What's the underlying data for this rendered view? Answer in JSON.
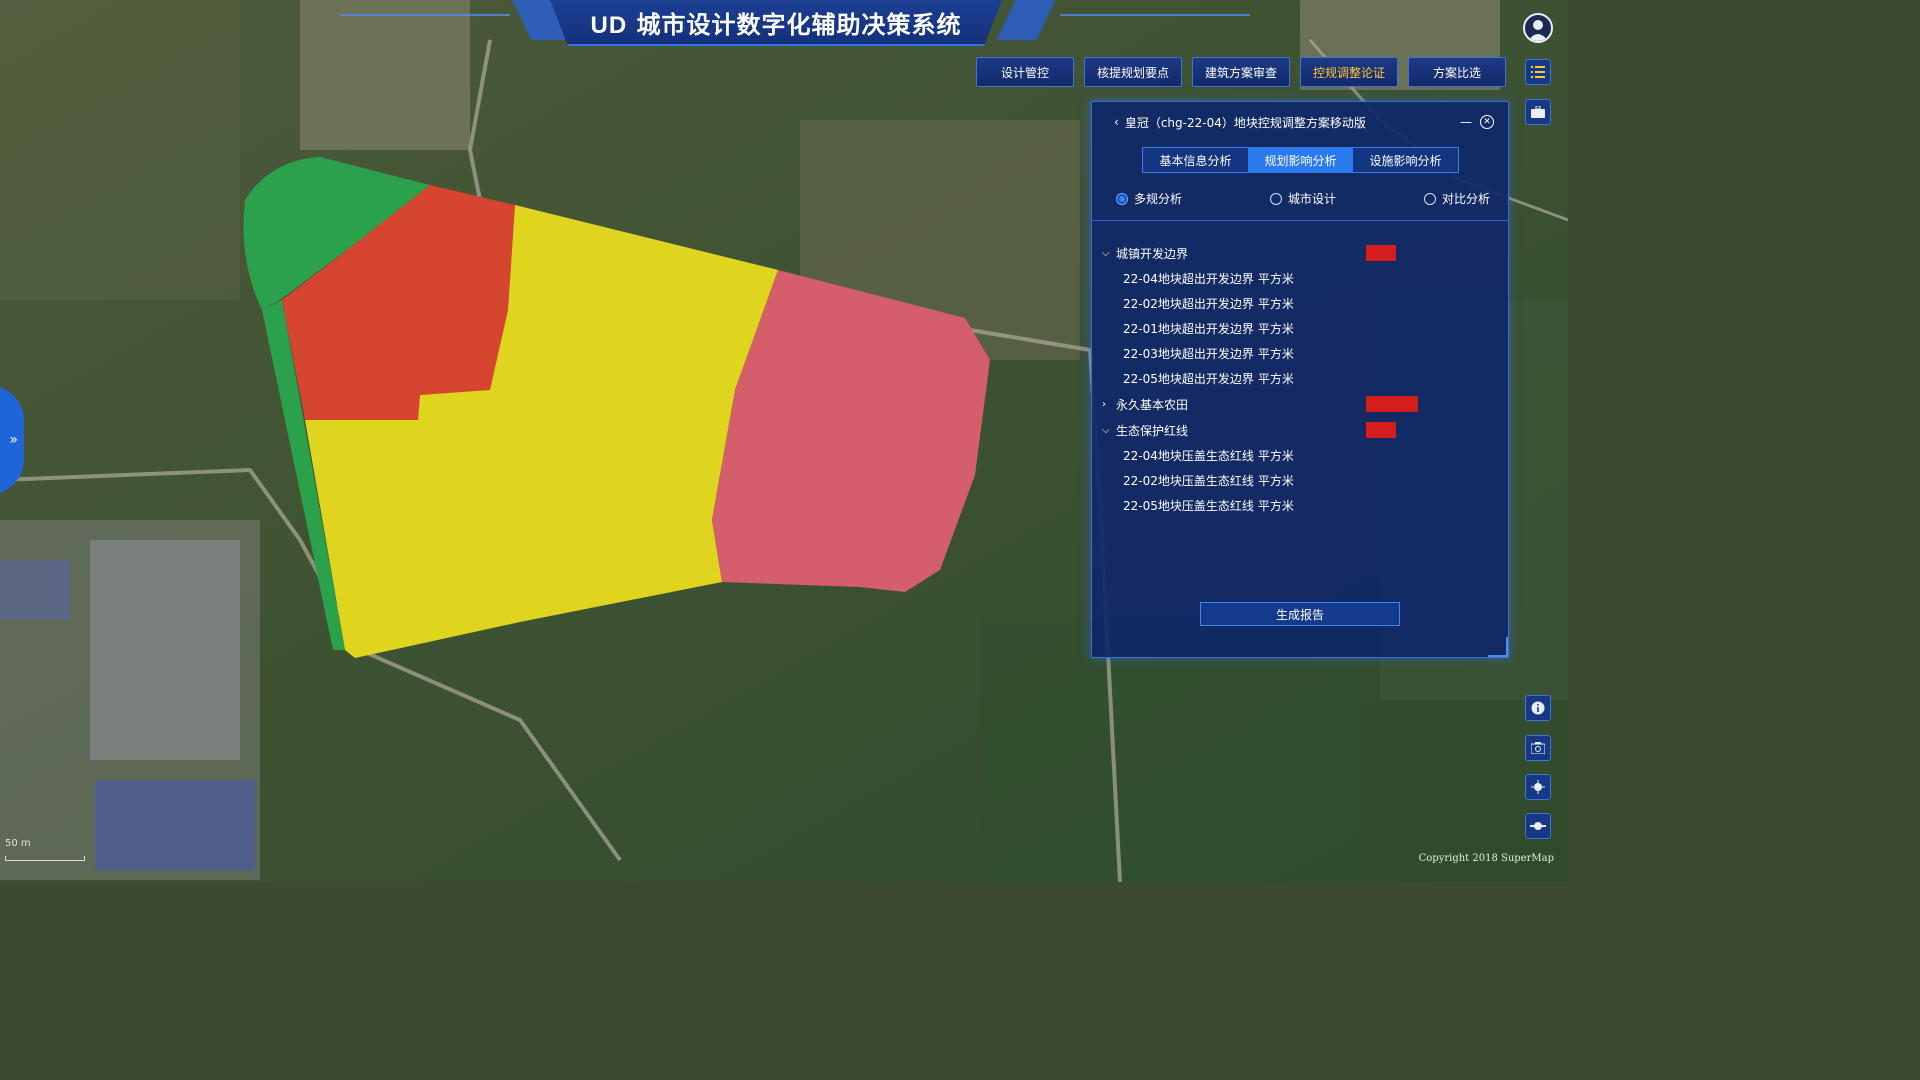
{
  "app": {
    "title_prefix": "UD",
    "title_main": "城市设计数字化辅助决策系统"
  },
  "nav": {
    "items": [
      {
        "label": "设计管控"
      },
      {
        "label": "核提规划要点"
      },
      {
        "label": "建筑方案审查"
      },
      {
        "label": "控规调整论证",
        "active": true
      },
      {
        "label": "方案比选"
      }
    ]
  },
  "panel": {
    "title": "皇冠（chg-22-04）地块控规调整方案移动版",
    "tabs": [
      {
        "label": "基本信息分析"
      },
      {
        "label": "规划影响分析",
        "active": true
      },
      {
        "label": "设施影响分析"
      }
    ],
    "radios": [
      {
        "label": "多规分析",
        "checked": true
      },
      {
        "label": "城市设计",
        "checked": false
      },
      {
        "label": "对比分析",
        "checked": false
      }
    ],
    "groups": [
      {
        "label": "城镇开发边界",
        "expanded": true,
        "items": [
          {
            "name": "22-04地块超出开发边界",
            "value": "",
            "unit": "平方米"
          },
          {
            "name": "22-02地块超出开发边界",
            "value": "",
            "unit": "平方米"
          },
          {
            "name": "22-01地块超出开发边界",
            "value": "",
            "unit": "平方米"
          },
          {
            "name": "22-03地块超出开发边界",
            "value": "",
            "unit": "平方米"
          },
          {
            "name": "22-05地块超出开发边界",
            "value": "",
            "unit": "平方米"
          }
        ]
      },
      {
        "label": "永久基本农田",
        "expanded": false,
        "items": []
      },
      {
        "label": "生态保护红线",
        "expanded": true,
        "items": [
          {
            "name": "22-04地块压盖生态红线",
            "value": "",
            "unit": "平方米"
          },
          {
            "name": "22-02地块压盖生态红线",
            "value": "",
            "unit": "平方米"
          },
          {
            "name": "22-05地块压盖生态红线",
            "value": "",
            "unit": "平方米"
          }
        ]
      }
    ],
    "report_button": "生成报告"
  },
  "map": {
    "scale_label": "50 m",
    "copyright": "Copyright 2018 SuperMap",
    "parcel_colors": {
      "green": "#2aa14a",
      "red": "#d64530",
      "yellow": "#e0d51e",
      "pink": "#d45e6a"
    }
  },
  "tools": {
    "icons": [
      "user-avatar-icon",
      "list-menu-icon",
      "briefcase-icon",
      "info-icon",
      "camera-icon",
      "locate-icon",
      "toggle-icon"
    ]
  },
  "colors": {
    "accent": "#2a7af0",
    "active_nav_text": "#ffc830",
    "alert_red": "#d61e1e"
  }
}
